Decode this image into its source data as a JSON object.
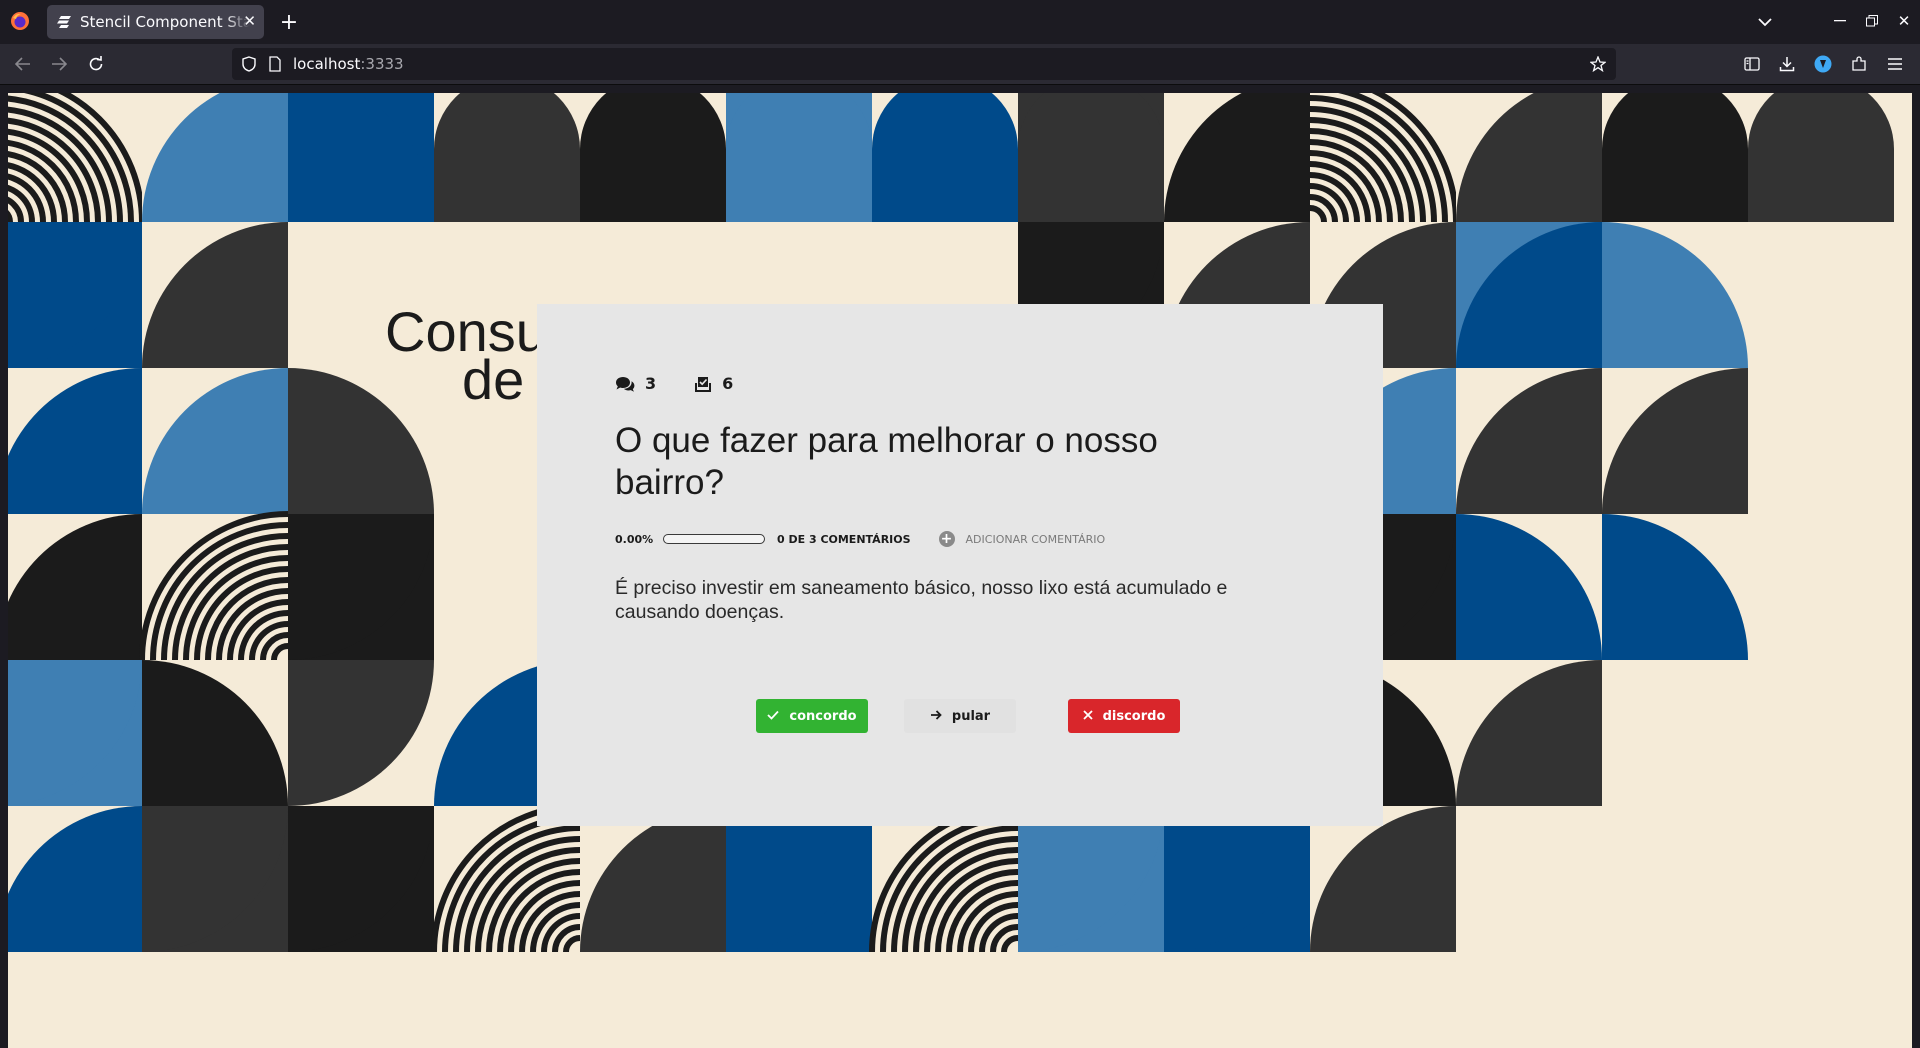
{
  "browser": {
    "tab_title": "Stencil Component Starter",
    "url_host": "localhost",
    "url_port": ":3333"
  },
  "page": {
    "hero_line1": "Consu",
    "hero_line2": "de",
    "colors": {
      "cream": "#f5ebd8",
      "light_blue": "#3f7fb3",
      "dark_blue": "#004a8a",
      "charcoal": "#333333",
      "black": "#1b1b1b"
    }
  },
  "card": {
    "comments_count": "3",
    "votes_count": "6",
    "question": "O que fazer para melhorar o nosso bairro?",
    "progress_percent": "0.00%",
    "progress_fraction": 0,
    "progress_text": "0 DE 3 COMENTÁRIOS",
    "add_comment": "ADICIONAR COMENTÁRIO",
    "comment_text": "É preciso investir em saneamento básico, nosso lixo está acumulado e causando doenças.",
    "buttons": {
      "agree": "concordo",
      "skip": "pular",
      "disagree": "discordo"
    },
    "icons": {
      "comments": "comments-icon",
      "votes": "vote-box-icon"
    }
  }
}
